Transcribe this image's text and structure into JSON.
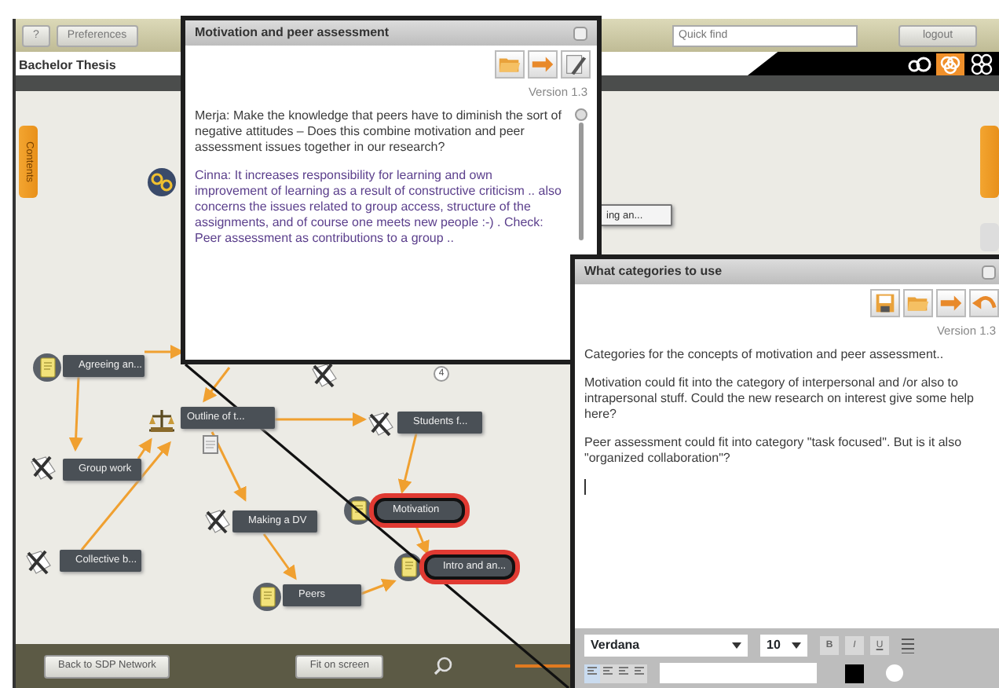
{
  "toolbar": {
    "help_button": "?",
    "preferences_button": "Preferences",
    "quick_find": {
      "placeholder": "Quick find"
    },
    "logout_button": "logout"
  },
  "project_title": "Bachelor Thesis",
  "view_buttons": [
    {
      "kind": "rings",
      "selected": false
    },
    {
      "kind": "linked",
      "selected": true
    },
    {
      "kind": "grid",
      "selected": false
    }
  ],
  "side_tab": "Contents",
  "nodes": [
    {
      "label": "Agreeing an...",
      "kind": "note",
      "highlighted": false
    },
    {
      "label": "Outline of t...",
      "kind": "scales",
      "highlighted": false
    },
    {
      "label": "Group work",
      "kind": "tool",
      "highlighted": false
    },
    {
      "label": "Making a DV",
      "kind": "tool",
      "highlighted": false
    },
    {
      "label": "Collective b...",
      "kind": "tool",
      "highlighted": false
    },
    {
      "label": "Peers",
      "kind": "note",
      "highlighted": false
    },
    {
      "label": "Motivation",
      "kind": "note",
      "highlighted": true
    },
    {
      "label": "Intro and an...",
      "kind": "note",
      "highlighted": true
    },
    {
      "label": "Students f...",
      "kind": "tool",
      "highlighted": false
    },
    {
      "kind": "tool"
    },
    {
      "kind": "links"
    },
    {
      "label": "ing an...",
      "kind": "plain"
    }
  ],
  "node_badge": "4",
  "bottom_bar": {
    "back_button": "Back to SDP Network",
    "fit_button": "Fit on screen"
  },
  "note_windows": [
    {
      "title": "Motivation and peer assessment",
      "tools": [
        {
          "kind": "open"
        },
        {
          "kind": "forward"
        },
        {
          "kind": "edit"
        }
      ],
      "version": "Version 1.3",
      "paragraphs": [
        {
          "text": "Merja: Make the knowledge that peers have to diminish the sort of negative attitudes – Does this combine motivation and peer assessment issues together in our research?",
          "color": "#3b3b3b"
        },
        {
          "text": "Cinna: It increases responsibility for learning and own improvement of learning as a result of constructive criticism .. also concerns the issues related to group access, structure of the assignments, and of course one meets new people :-) . Check: Peer assessment as contributions to a group ..",
          "color": "#5b3f8c"
        }
      ]
    },
    {
      "title": "What categories to use",
      "tools": [
        {
          "kind": "save"
        },
        {
          "kind": "open"
        },
        {
          "kind": "forward"
        },
        {
          "kind": "undo"
        }
      ],
      "version": "Version 1.3",
      "paragraphs": [
        {
          "text": "Categories for the concepts of motivation and peer assessment..",
          "color": "#3b3b3b"
        },
        {
          "text": "Motivation could fit into the category of interpersonal and /or also to intrapersonal stuff. Could the  new research on interest give some help here?",
          "color": "#3b3b3b"
        },
        {
          "text": "Peer assessment could fit into category \"task focused\". But is it also \"organized collaboration\"?",
          "color": "#3b3b3b"
        }
      ],
      "editor": {
        "font": "Verdana",
        "size": "10",
        "style_buttons": [
          "B",
          "I",
          "U"
        ],
        "color": "#000000"
      }
    }
  ]
}
